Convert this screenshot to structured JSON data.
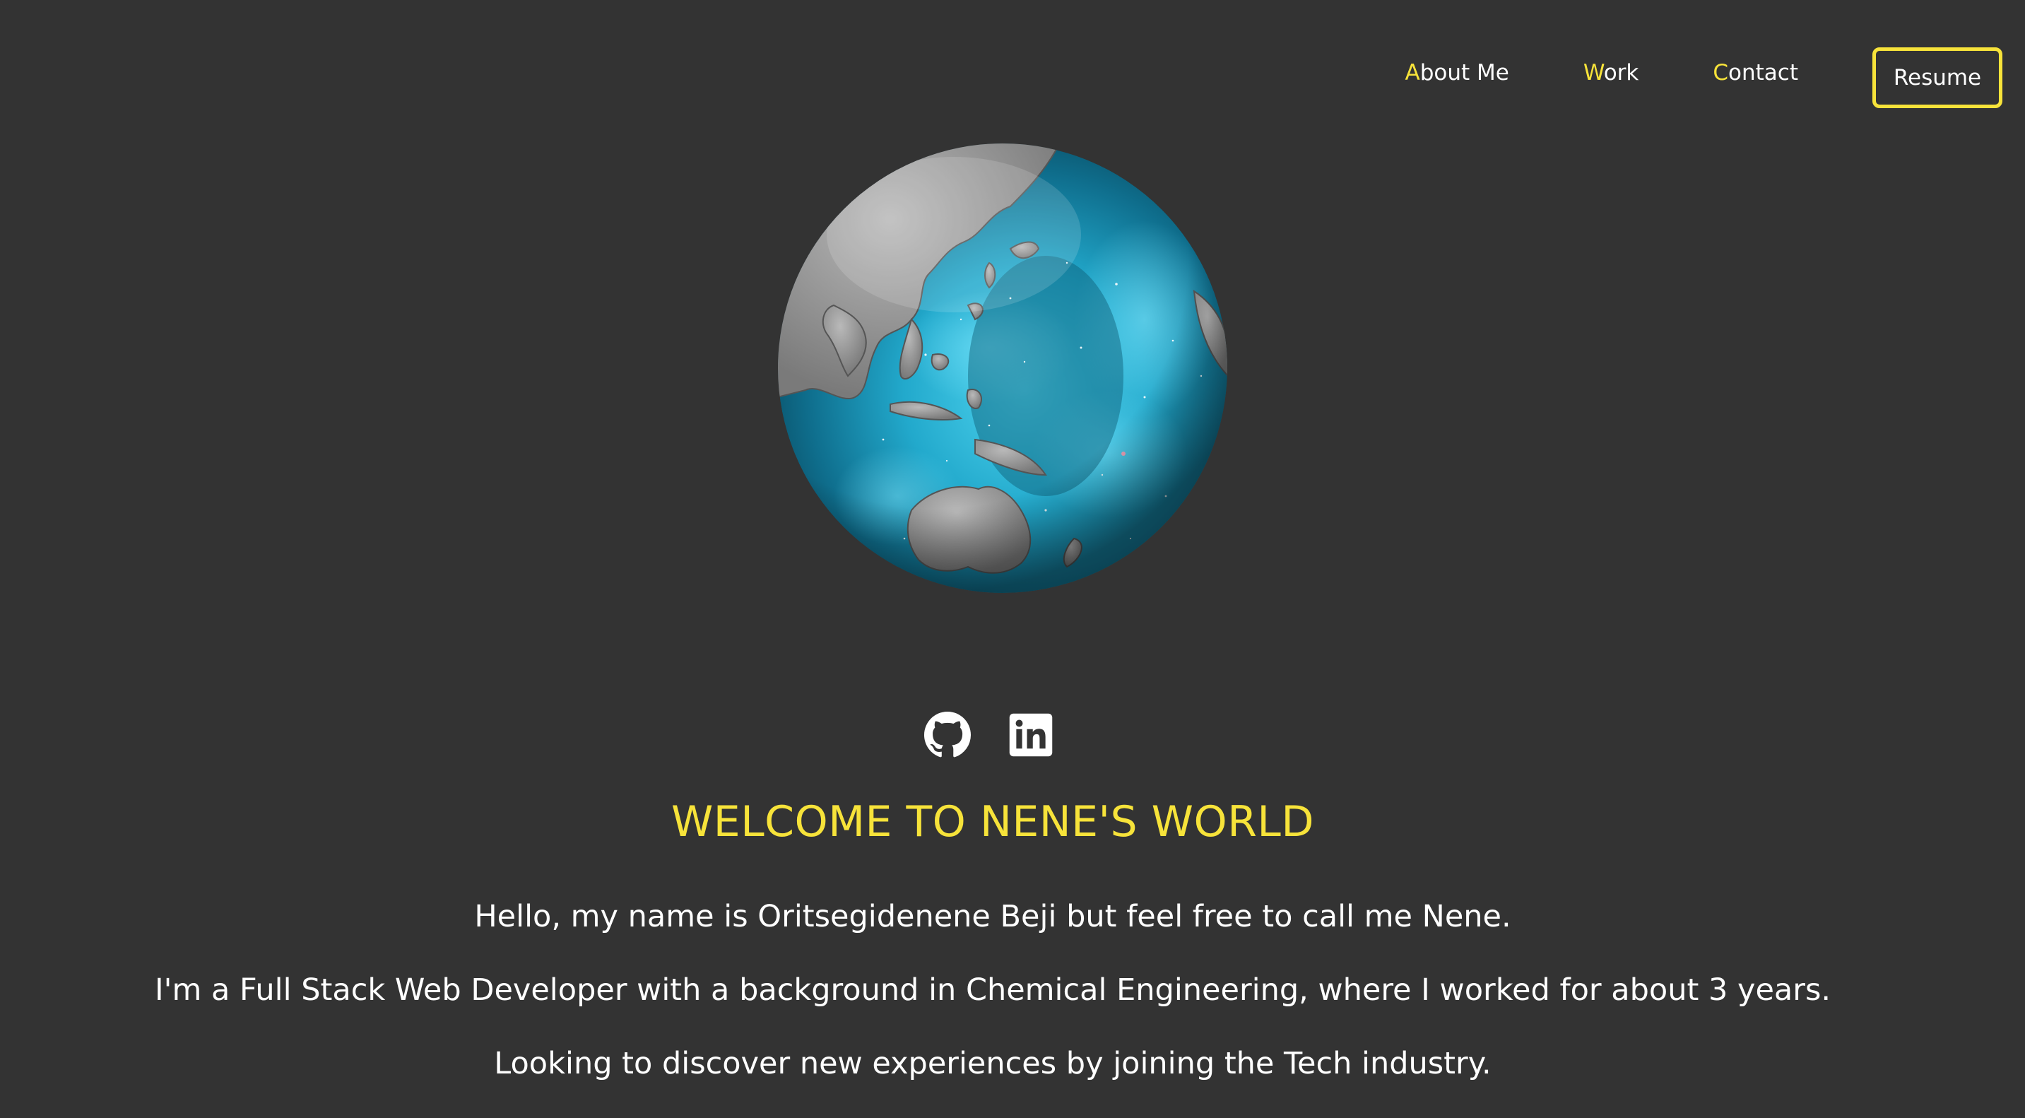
{
  "nav": {
    "links": [
      {
        "initial": "A",
        "rest": "bout Me"
      },
      {
        "initial": "W",
        "rest": "ork"
      },
      {
        "initial": "C",
        "rest": "ontact"
      }
    ],
    "resume_label": "Resume"
  },
  "social": {
    "icons": [
      "github-icon",
      "linkedin-icon"
    ]
  },
  "hero": {
    "title": "WELCOME TO NENE'S WORLD",
    "lines": [
      "Hello, my name is Oritsegidenene Beji but feel free to call me Nene.",
      "I'm a Full Stack Web Developer with a background in Chemical Engineering, where I worked for about 3 years.",
      "Looking to discover new experiences by joining the Tech industry."
    ]
  },
  "colors": {
    "background": "#333333",
    "accent": "#f7e33a",
    "text": "#ffffff",
    "globe_ocean": "#29b6d6"
  }
}
